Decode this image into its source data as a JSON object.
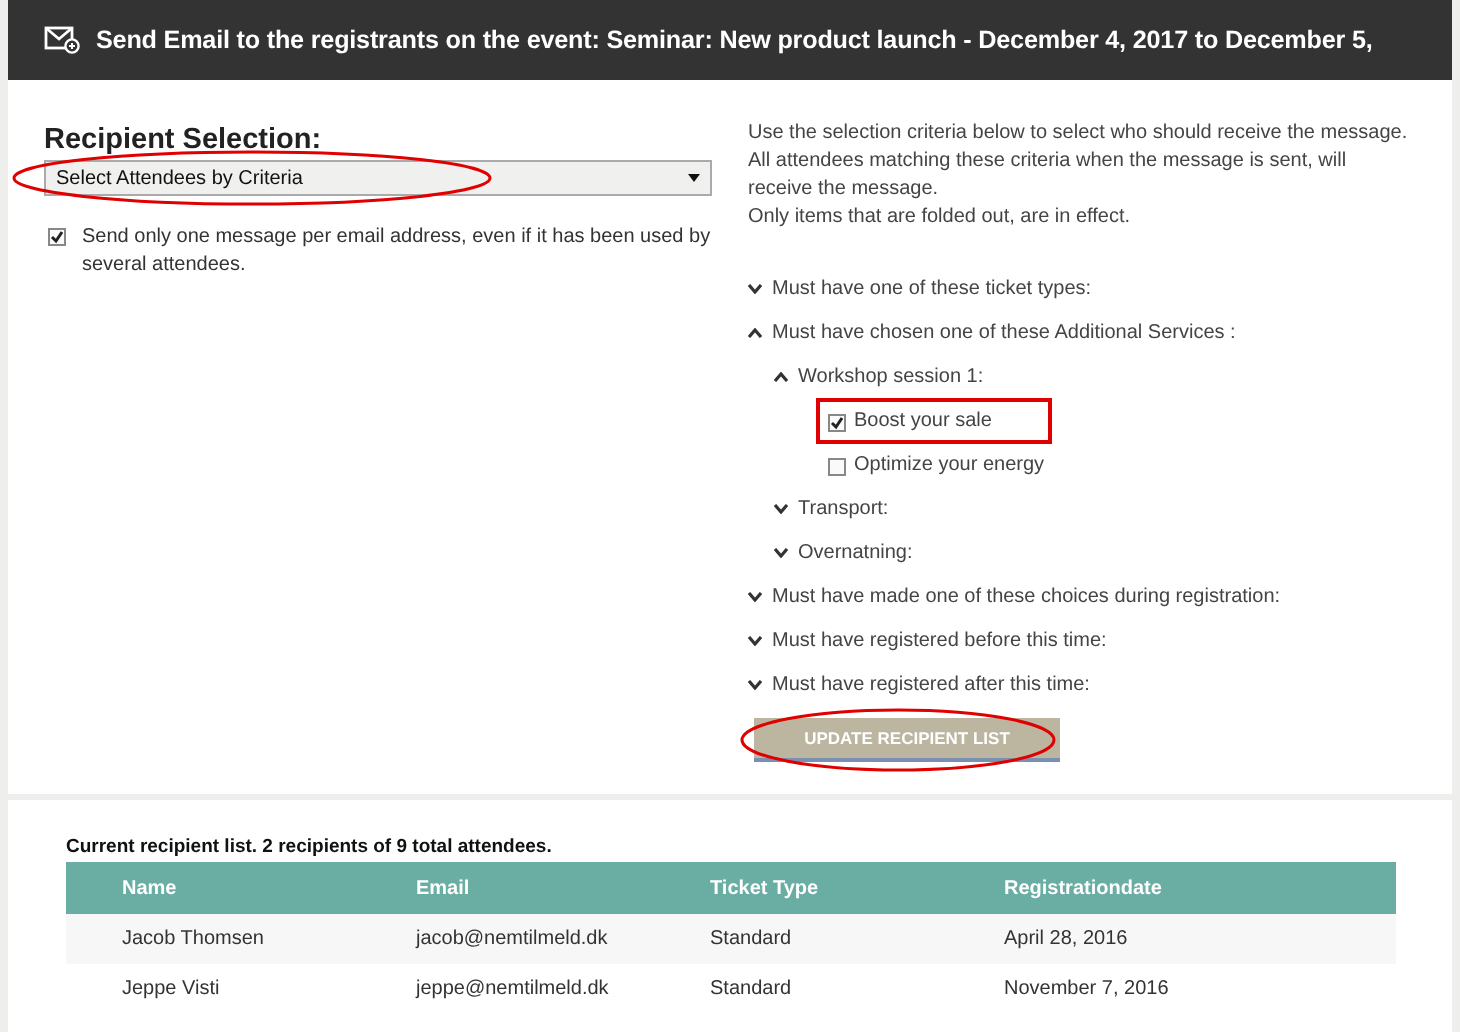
{
  "header": {
    "title": "Send Email to the registrants on the event: Seminar: New product launch - December 4, 2017 to December 5,"
  },
  "recipient_selection": {
    "heading": "Recipient Selection:",
    "dropdown": {
      "value": "Select Attendees by Criteria"
    },
    "one_per_email": {
      "label": "Send only one message per email address, even if it has been used by several attendees.",
      "checked": true
    }
  },
  "instructions": [
    "Use the selection criteria below to select who should receive the message. All attendees matching these criteria when the message is sent, will receive the message.",
    "Only items that are folded out, are in effect."
  ],
  "criteria": [
    {
      "kind": "group",
      "label": "Must have one of these ticket types:",
      "expanded": false
    },
    {
      "kind": "group",
      "label": "Must have chosen one of these Additional Services :",
      "expanded": true,
      "children": [
        {
          "kind": "group",
          "label": "Workshop session 1:",
          "expanded": true,
          "children": [
            {
              "kind": "option",
              "label": "Boost your sale",
              "checked": true,
              "highlighted": true
            },
            {
              "kind": "option",
              "label": "Optimize your energy",
              "checked": false,
              "highlighted": false
            }
          ]
        },
        {
          "kind": "group",
          "label": "Transport:",
          "expanded": false
        },
        {
          "kind": "group",
          "label": "Overnatning:",
          "expanded": false
        }
      ]
    },
    {
      "kind": "group",
      "label": "Must have made one of these choices during registration:",
      "expanded": false
    },
    {
      "kind": "group",
      "label": "Must have registered before this time:",
      "expanded": false
    },
    {
      "kind": "group",
      "label": "Must have registered after this time:",
      "expanded": false
    }
  ],
  "update_button": {
    "label": "UPDATE RECIPIENT LIST"
  },
  "recipients": {
    "summary": "Current recipient list. 2 recipients of 9 total attendees.",
    "columns": [
      "Name",
      "Email",
      "Ticket Type",
      "Registrationdate"
    ],
    "rows": [
      [
        "Jacob Thomsen",
        "jacob@nemtilmeld.dk",
        "Standard",
        "April 28, 2016"
      ],
      [
        "Jeppe Visti",
        "jeppe@nemtilmeld.dk",
        "Standard",
        "November 7, 2016"
      ]
    ]
  }
}
